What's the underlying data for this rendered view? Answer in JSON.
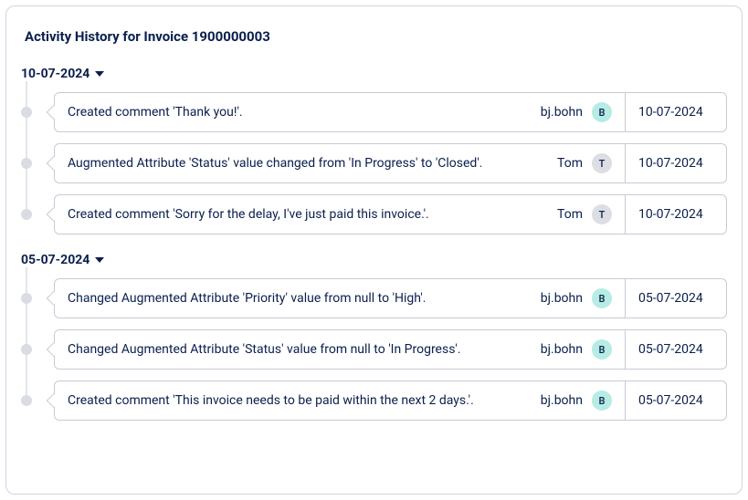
{
  "title": "Activity History for Invoice 1900000003",
  "groups": [
    {
      "date": "10-07-2024",
      "entries": [
        {
          "message": "Created comment 'Thank you!'.",
          "user": "bj.bohn",
          "initial": "B",
          "color": "teal",
          "date": "10-07-2024"
        },
        {
          "message": "Augmented Attribute 'Status' value changed from 'In Progress' to 'Closed'.",
          "user": "Tom",
          "initial": "T",
          "color": "grey",
          "date": "10-07-2024"
        },
        {
          "message": "Created comment 'Sorry for the delay, I've just paid this invoice.'.",
          "user": "Tom",
          "initial": "T",
          "color": "grey",
          "date": "10-07-2024"
        }
      ]
    },
    {
      "date": "05-07-2024",
      "entries": [
        {
          "message": "Changed Augmented Attribute 'Priority' value from null to 'High'.",
          "user": "bj.bohn",
          "initial": "B",
          "color": "teal",
          "date": "05-07-2024"
        },
        {
          "message": "Changed Augmented Attribute 'Status' value from null to 'In Progress'.",
          "user": "bj.bohn",
          "initial": "B",
          "color": "teal",
          "date": "05-07-2024"
        },
        {
          "message": "Created comment 'This invoice needs to be paid within the next 2 days.'.",
          "user": "bj.bohn",
          "initial": "B",
          "color": "teal",
          "date": "05-07-2024"
        }
      ]
    }
  ]
}
